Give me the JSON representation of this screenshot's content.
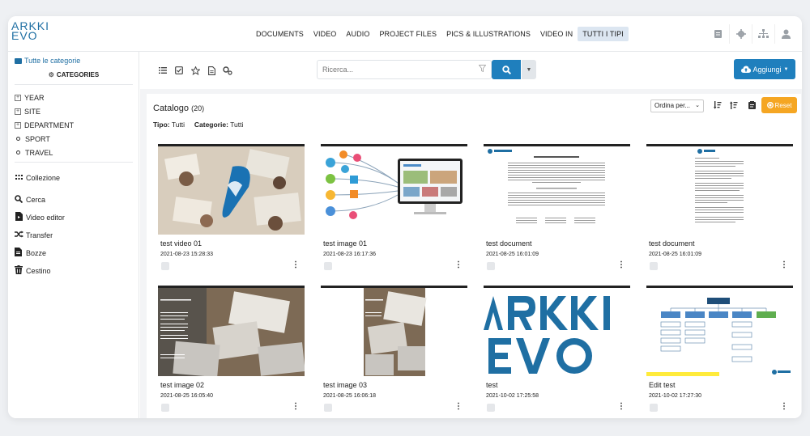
{
  "app": {
    "logo_top": "ARKKI",
    "logo_bottom": "EVO"
  },
  "nav": {
    "items": [
      "DOCUMENTS",
      "VIDEO",
      "AUDIO",
      "PROJECT FILES",
      "PICS & ILLUSTRATIONS",
      "VIDEO IN",
      "TUTTI I TIPI"
    ],
    "active_index": 6
  },
  "top_icons": [
    "clipboard-icon",
    "gear-icon",
    "sitemap-icon",
    "user-icon"
  ],
  "sidebar": {
    "all_categories": "Tutte le categorie",
    "categories_label": "CATEGORIES",
    "tree": [
      {
        "label": "YEAR",
        "type": "expandable"
      },
      {
        "label": "SITE",
        "type": "expandable"
      },
      {
        "label": "DEPARTMENT",
        "type": "expandable"
      },
      {
        "label": "SPORT",
        "type": "leaf"
      },
      {
        "label": "TRAVEL",
        "type": "leaf"
      }
    ],
    "collection": "Collezione",
    "menu": [
      {
        "label": "Cerca",
        "icon": "search-icon"
      },
      {
        "label": "Video editor",
        "icon": "video-file-icon"
      },
      {
        "label": "Transfer",
        "icon": "shuffle-icon"
      },
      {
        "label": "Bozze",
        "icon": "drafts-icon"
      },
      {
        "label": "Cestino",
        "icon": "trash-icon"
      }
    ]
  },
  "toolbar": {
    "icons": [
      "list-icon",
      "checkbox-icon",
      "star-icon",
      "document-icon",
      "settings-icon"
    ],
    "search_placeholder": "Ricerca...",
    "add_label": "Aggiungi"
  },
  "catalog": {
    "title": "Catalogo",
    "count": "(20)",
    "type_label": "Tipo:",
    "type_value": "Tutti",
    "category_label": "Categorie:",
    "category_value": "Tutti",
    "sort_label": "Ordina per...",
    "reset_label": "Reset"
  },
  "items": [
    {
      "title": "test video 01",
      "date": "2021-08-23 15:28:33",
      "thumb": "photo-desk"
    },
    {
      "title": "test image 01",
      "date": "2021-08-23 16:17:36",
      "thumb": "illustration-monitor"
    },
    {
      "title": "test document",
      "date": "2021-08-25 16:01:09",
      "thumb": "document-page"
    },
    {
      "title": "test document",
      "date": "2021-08-25 16:01:09",
      "thumb": "document-page-2"
    },
    {
      "title": "test image 02",
      "date": "2021-08-25 16:05:40",
      "thumb": "photo-laptops"
    },
    {
      "title": "test image 03",
      "date": "2021-08-25 16:06:18",
      "thumb": "photo-laptops-narrow"
    },
    {
      "title": "test",
      "date": "2021-10-02 17:25:58",
      "thumb": "logo-large"
    },
    {
      "title": "Edit test",
      "date": "2021-10-02 17:27:30",
      "thumb": "org-chart"
    }
  ],
  "colors": {
    "primary": "#1f7fbd",
    "reset": "#f5a623",
    "logo": "#1f6fa3"
  }
}
